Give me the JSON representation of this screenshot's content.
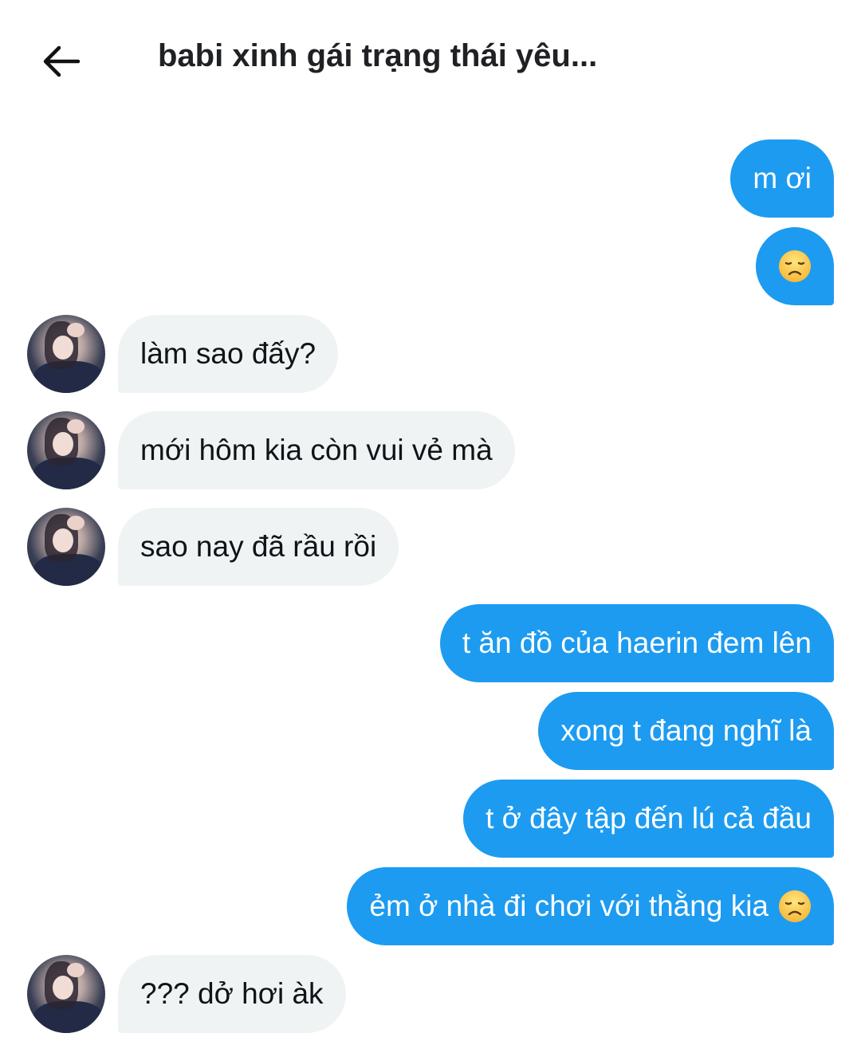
{
  "header": {
    "back_icon": "arrow-left-icon",
    "title": "babi xinh gái trạng thái yêu..."
  },
  "colors": {
    "outgoing_bubble": "#1d9bf0",
    "incoming_bubble": "#eff3f4"
  },
  "messages": [
    {
      "direction": "out",
      "text": "m ơi"
    },
    {
      "direction": "out",
      "text": "",
      "emoji": "disappointed-face-emoji"
    },
    {
      "direction": "in",
      "text": "làm sao đấy?"
    },
    {
      "direction": "in",
      "text": "mới hôm kia còn vui vẻ mà"
    },
    {
      "direction": "in",
      "text": "sao nay đã rầu rồi"
    },
    {
      "direction": "out",
      "text": "t ăn đồ của haerin đem lên"
    },
    {
      "direction": "out",
      "text": "xong t đang nghĩ là"
    },
    {
      "direction": "out",
      "text": "t ở đây tập đến lú cả đầu"
    },
    {
      "direction": "out",
      "text": "ẻm ở nhà đi chơi với thằng kia",
      "emoji": "disappointed-face-emoji"
    },
    {
      "direction": "in",
      "text": "??? dở hơi àk"
    }
  ]
}
